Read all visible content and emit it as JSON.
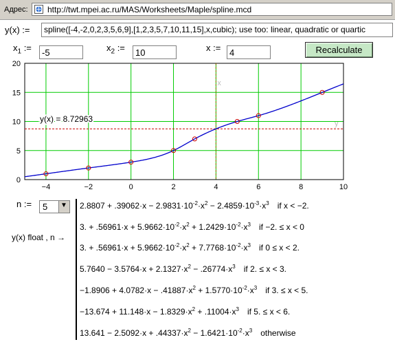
{
  "address_bar": {
    "label": "Адрес:",
    "url": "http://twt.mpei.ac.ru/MAS/Worksheets/Maple/spline.mcd"
  },
  "definition": {
    "lhs": "y(x) :=",
    "value": "spline([-4,-2,0,2,3,5,6,9],[1,2,3,5,7,10,11,15],x,cubic); use too: linear, quadratic or quartic"
  },
  "inputs": {
    "x1_label": "x",
    "x1_sub": "1",
    "x1_assign": ":=",
    "x1_value": "-5",
    "x2_label": "x",
    "x2_sub": "2",
    "x2_assign": ":=",
    "x2_value": "10",
    "x_label": "x :=",
    "x_value": "4",
    "recalc_label": "Recalculate"
  },
  "chart_data": {
    "type": "line",
    "xlim": [
      -5,
      10
    ],
    "ylim": [
      0,
      20
    ],
    "x_ticks": [
      "-4",
      "-2",
      "0",
      "2",
      "4",
      "6",
      "8",
      "10"
    ],
    "y_ticks": [
      "0",
      "5",
      "10",
      "15",
      "20"
    ],
    "grid": true,
    "knots": {
      "x": [
        -4,
        -2,
        0,
        2,
        3,
        5,
        6,
        9
      ],
      "y": [
        1,
        2,
        3,
        5,
        7,
        10,
        11,
        15
      ]
    },
    "marker_x": 4,
    "marker_y": 8.72963,
    "marker_label": "y(x) = 8.72963",
    "vline_label": "x",
    "hline_label": "y",
    "colors": {
      "curve": "#0000cc",
      "grid": "#00cc00",
      "knots": "#cc0000",
      "hline": "#cc0000",
      "vline": "#996600"
    }
  },
  "n_control": {
    "label": "n :=",
    "value": "5",
    "arrow": "▼"
  },
  "result": {
    "label": "y(x) float , n  →"
  },
  "pieces": [
    {
      "pre": "2.8807 + .39062·x − 2.9831·10",
      "e1": "-2",
      "mid1": "·x",
      "e2": "2",
      "mid2": " − 2.4859·10",
      "e3": "-3",
      "mid3": "·x",
      "e4": "3",
      "cond": "if   x < −2."
    },
    {
      "pre": "3. + .56961·x + 5.9662·10",
      "e1": "-2",
      "mid1": "·x",
      "e2": "2",
      "mid2": " + 1.2429·10",
      "e3": "-2",
      "mid3": "·x",
      "e4": "3",
      "cond": "if   −2. ≤ x < 0"
    },
    {
      "pre": "3. + .56961·x + 5.9662·10",
      "e1": "-2",
      "mid1": "·x",
      "e2": "2",
      "mid2": " + 7.7768·10",
      "e3": "-2",
      "mid3": "·x",
      "e4": "3",
      "cond": "if   0 ≤ x < 2."
    },
    {
      "pre": "5.7640 − 3.5764·x + 2.1327·x",
      "e1": "2",
      "mid1": " − .26774·x",
      "e2": "3",
      "mid2": "",
      "e3": "",
      "mid3": "",
      "e4": "",
      "cond": "if   2. ≤ x < 3."
    },
    {
      "pre": "−1.8906 + 4.0782·x − .41887·x",
      "e1": "2",
      "mid1": " + 1.5770·10",
      "e2": "-2",
      "mid2": "·x",
      "e3": "3",
      "mid3": "",
      "e4": "",
      "cond": "if   3. ≤ x < 5."
    },
    {
      "pre": "−13.674 + 11.148·x − 1.8329·x",
      "e1": "2",
      "mid1": " + .11004·x",
      "e2": "3",
      "mid2": "",
      "e3": "",
      "mid3": "",
      "e4": "",
      "cond": "if   5. ≤ x < 6."
    },
    {
      "pre": "13.641 − 2.5092·x + .44337·x",
      "e1": "2",
      "mid1": " − 1.6421·10",
      "e2": "-2",
      "mid2": "·x",
      "e3": "3",
      "mid3": "",
      "e4": "",
      "cond": "otherwise"
    }
  ]
}
